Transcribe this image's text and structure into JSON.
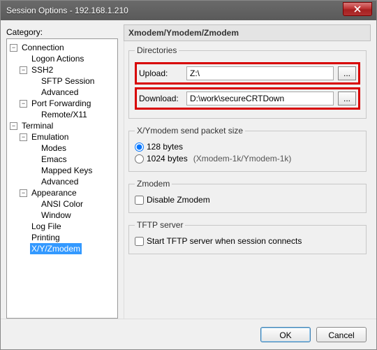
{
  "window": {
    "title": "Session Options - 192.168.1.210"
  },
  "category_label": "Category:",
  "tree": {
    "connection": "Connection",
    "logon_actions": "Logon Actions",
    "ssh2": "SSH2",
    "sftp_session": "SFTP Session",
    "advanced_ssh": "Advanced",
    "port_forwarding": "Port Forwarding",
    "remote_x11": "Remote/X11",
    "terminal": "Terminal",
    "emulation": "Emulation",
    "modes": "Modes",
    "emacs": "Emacs",
    "mapped_keys": "Mapped Keys",
    "advanced_emu": "Advanced",
    "appearance": "Appearance",
    "ansi_color": "ANSI Color",
    "window": "Window",
    "log_file": "Log File",
    "printing": "Printing",
    "xyzmodem": "X/Y/Zmodem"
  },
  "panel": {
    "header": "Xmodem/Ymodem/Zmodem",
    "directories": {
      "legend": "Directories",
      "upload_label": "Upload:",
      "upload_value": "Z:\\",
      "download_label": "Download:",
      "download_value": "D:\\work\\secureCRTDown",
      "browse": "..."
    },
    "packet": {
      "legend": "X/Ymodem send packet size",
      "opt128": "128 bytes",
      "opt1024": "1024 bytes",
      "opt1024_suffix": "(Xmodem-1k/Ymodem-1k)"
    },
    "zmodem": {
      "legend": "Zmodem",
      "disable": "Disable Zmodem"
    },
    "tftp": {
      "legend": "TFTP server",
      "start": "Start TFTP server when session connects"
    }
  },
  "buttons": {
    "ok": "OK",
    "cancel": "Cancel"
  }
}
